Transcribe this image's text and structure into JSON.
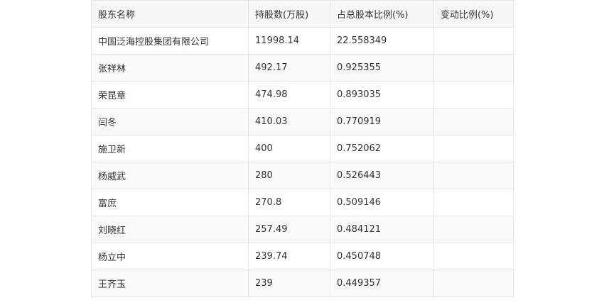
{
  "table": {
    "headers": [
      "股东名称",
      "持股数(万股)",
      "占总股本比例(%)",
      "变动比例(%)"
    ],
    "rows": [
      [
        "中国泛海控股集团有限公司",
        "11998.14",
        "22.558349",
        ""
      ],
      [
        "张祥林",
        "492.17",
        "0.925355",
        ""
      ],
      [
        "荣昆章",
        "474.98",
        "0.893035",
        ""
      ],
      [
        "闫冬",
        "410.03",
        "0.770919",
        ""
      ],
      [
        "施卫新",
        "400",
        "0.752062",
        ""
      ],
      [
        "杨威武",
        "280",
        "0.526443",
        ""
      ],
      [
        "富庶",
        "270.8",
        "0.509146",
        ""
      ],
      [
        "刘晓红",
        "257.49",
        "0.484121",
        ""
      ],
      [
        "杨立中",
        "239.74",
        "0.450748",
        ""
      ],
      [
        "王齐玉",
        "239",
        "0.449357",
        ""
      ]
    ]
  }
}
